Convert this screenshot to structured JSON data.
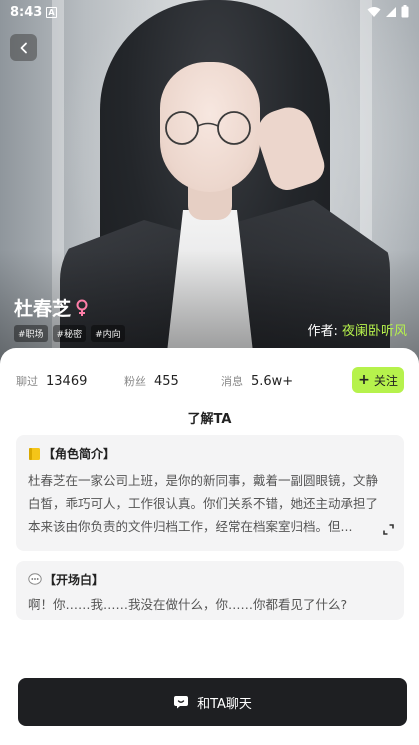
{
  "status_bar": {
    "time": "8:43",
    "notification_badge": "A"
  },
  "character": {
    "name": "杜春芝",
    "gender_icon": "female-symbol-icon",
    "tags": [
      "#职场",
      "#秘密",
      "#内向"
    ],
    "author_label": "作者:",
    "author_name": "夜阑卧听风"
  },
  "stats": {
    "chats_label": "聊过",
    "chats_value": "13469",
    "fans_label": "粉丝",
    "fans_value": "455",
    "messages_label": "消息",
    "messages_value": "5.6w+"
  },
  "follow": {
    "plus": "+",
    "label": "关注"
  },
  "section_title": "了解TA",
  "intro": {
    "title": "【角色简介】",
    "text": "杜春芝在一家公司上班，是你的新同事，戴着一副圆眼镜，文静白皙，乖巧可人，工作很认真。你们关系不错，她还主动承担了本来该由你负责的文件归档工作，经常在档案室归档。但..."
  },
  "opening": {
    "title": "【开场白】",
    "text": "啊！你……我……我没在做什么，你……你都看见了什么?"
  },
  "chat_button": {
    "label": "和TA聊天"
  },
  "colors": {
    "accent": "#b6f24c",
    "dark": "#1e1f22",
    "card_bg": "#f4f4f5",
    "gender": "#ff7ea8"
  }
}
